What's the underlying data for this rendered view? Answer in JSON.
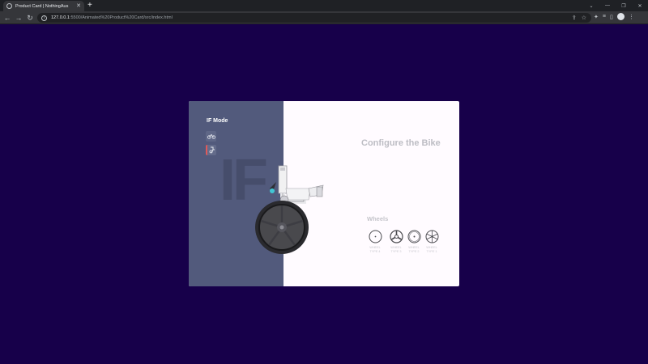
{
  "browser": {
    "tab_title": "Product Card | NothingAus",
    "new_tab_label": "+",
    "url_host": "127.0.0.1",
    "url_path": ":5500/Animated%20Product%20Card/src/index.html",
    "controls": {
      "minimize": "—",
      "restore": "❐",
      "close": "✕",
      "dropdown": "⌄"
    }
  },
  "card": {
    "mode_title": "IF Mode",
    "watermark": "IF",
    "heading": "Configure the Bike",
    "wheels_label": "Wheels",
    "mode_buttons": [
      {
        "icon": "bike-icon",
        "glyph": "⚲",
        "active": false
      },
      {
        "icon": "wheel-frame-icon",
        "glyph": "✱",
        "active": true
      }
    ],
    "wheel_options": [
      {
        "label": "WHEEL\nTYPE 4",
        "icon": "wheel-type-4-icon"
      },
      {
        "label": "WHEEL\nTYPE 3",
        "icon": "wheel-type-3-icon"
      },
      {
        "label": "WHEEL\nTYPE 2",
        "icon": "wheel-type-2-icon"
      },
      {
        "label": "WHEEL\nTYPE 1",
        "icon": "wheel-type-1-icon"
      }
    ]
  },
  "colors": {
    "page_background": "#17004a",
    "left_panel": "#525a7c",
    "card_background": "#fffbff",
    "active_indicator": "#e05a5a"
  }
}
